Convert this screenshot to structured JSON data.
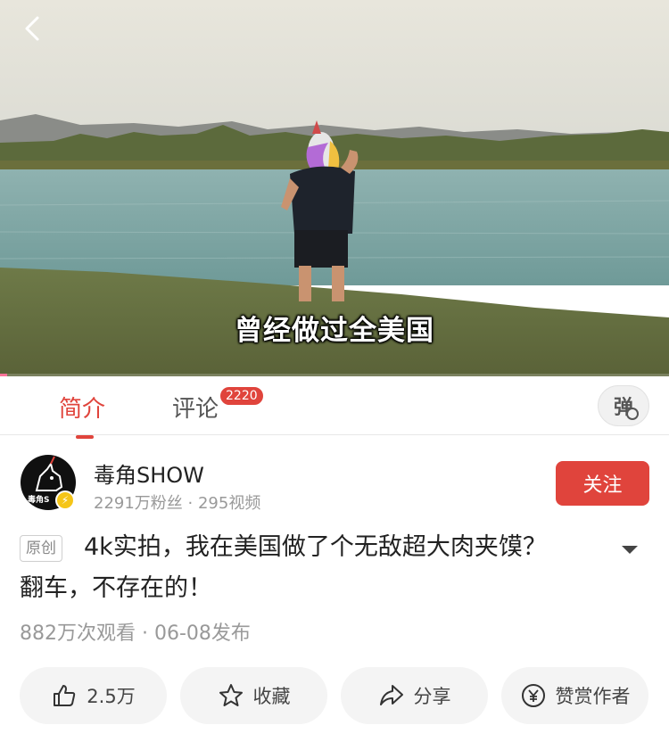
{
  "video": {
    "subtitle": "曾经做过全美国",
    "progress_fraction": 0.01
  },
  "tabs": {
    "intro_label": "简介",
    "comment_label": "评论",
    "comment_count": "2220",
    "danmaku_glyph": "弹"
  },
  "uploader": {
    "name": "毒角SHOW",
    "stats": "2291万粉丝 · 295视频",
    "avatar_text": "毒角S",
    "follow_label": "关注"
  },
  "video_info": {
    "original_tag": "原创",
    "title": "4k实拍，我在美国做了个无敌超大肉夹馍？翻车，不存在的！",
    "meta": "882万次观看 · 06-08发布"
  },
  "actions": {
    "like": "2.5万",
    "favorite": "收藏",
    "share": "分享",
    "tip": "赞赏作者"
  },
  "colors": {
    "accent": "#e0443c",
    "badge_bg": "#e0443c",
    "button_bg": "#f4f4f4"
  },
  "icons": [
    "back-arrow-icon",
    "danmaku-icon",
    "verified-icon",
    "chevron-down-icon",
    "thumbs-up-icon",
    "star-icon",
    "share-icon",
    "yen-coin-icon"
  ]
}
